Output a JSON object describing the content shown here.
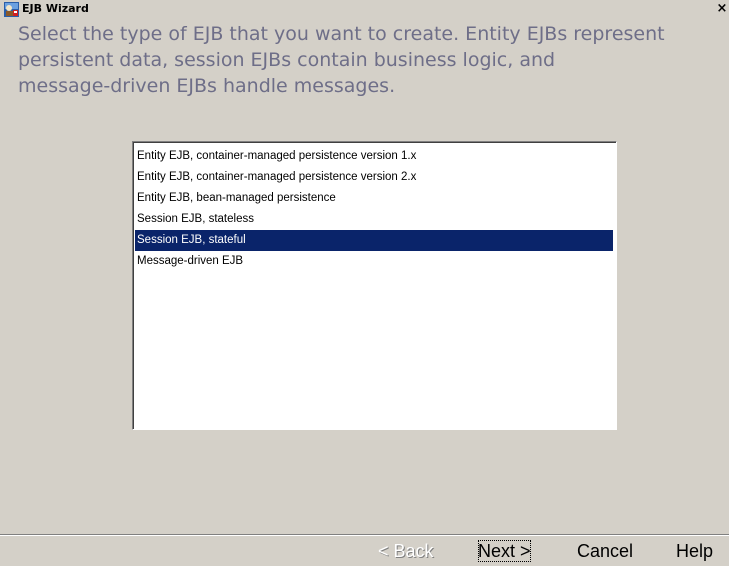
{
  "window": {
    "title": "EJB Wizard",
    "close_glyph": "×",
    "app_icon": "wizard-icon"
  },
  "instruction": {
    "line1": "Select the type of EJB that you want to create.  Entity EJBs represent",
    "line2": "persistent data, session EJBs contain business logic, and",
    "line3": "message-driven EJBs handle messages."
  },
  "ejb_types": {
    "selected_index": 4,
    "items": [
      {
        "label": "Entity EJB, container-managed persistence version 1.x"
      },
      {
        "label": "Entity EJB, container-managed persistence version 2.x"
      },
      {
        "label": "Entity EJB, bean-managed persistence"
      },
      {
        "label": "Session EJB, stateless"
      },
      {
        "label": "Session EJB, stateful"
      },
      {
        "label": "Message-driven EJB"
      }
    ]
  },
  "buttons": {
    "back": "< Back",
    "next": "Next >",
    "cancel": "Cancel",
    "help": "Help"
  },
  "colors": {
    "window_background": "#d4d0c8",
    "instruction_text": "#6e6e88",
    "selection_background": "#0a246a",
    "selection_text": "#ffffff"
  }
}
